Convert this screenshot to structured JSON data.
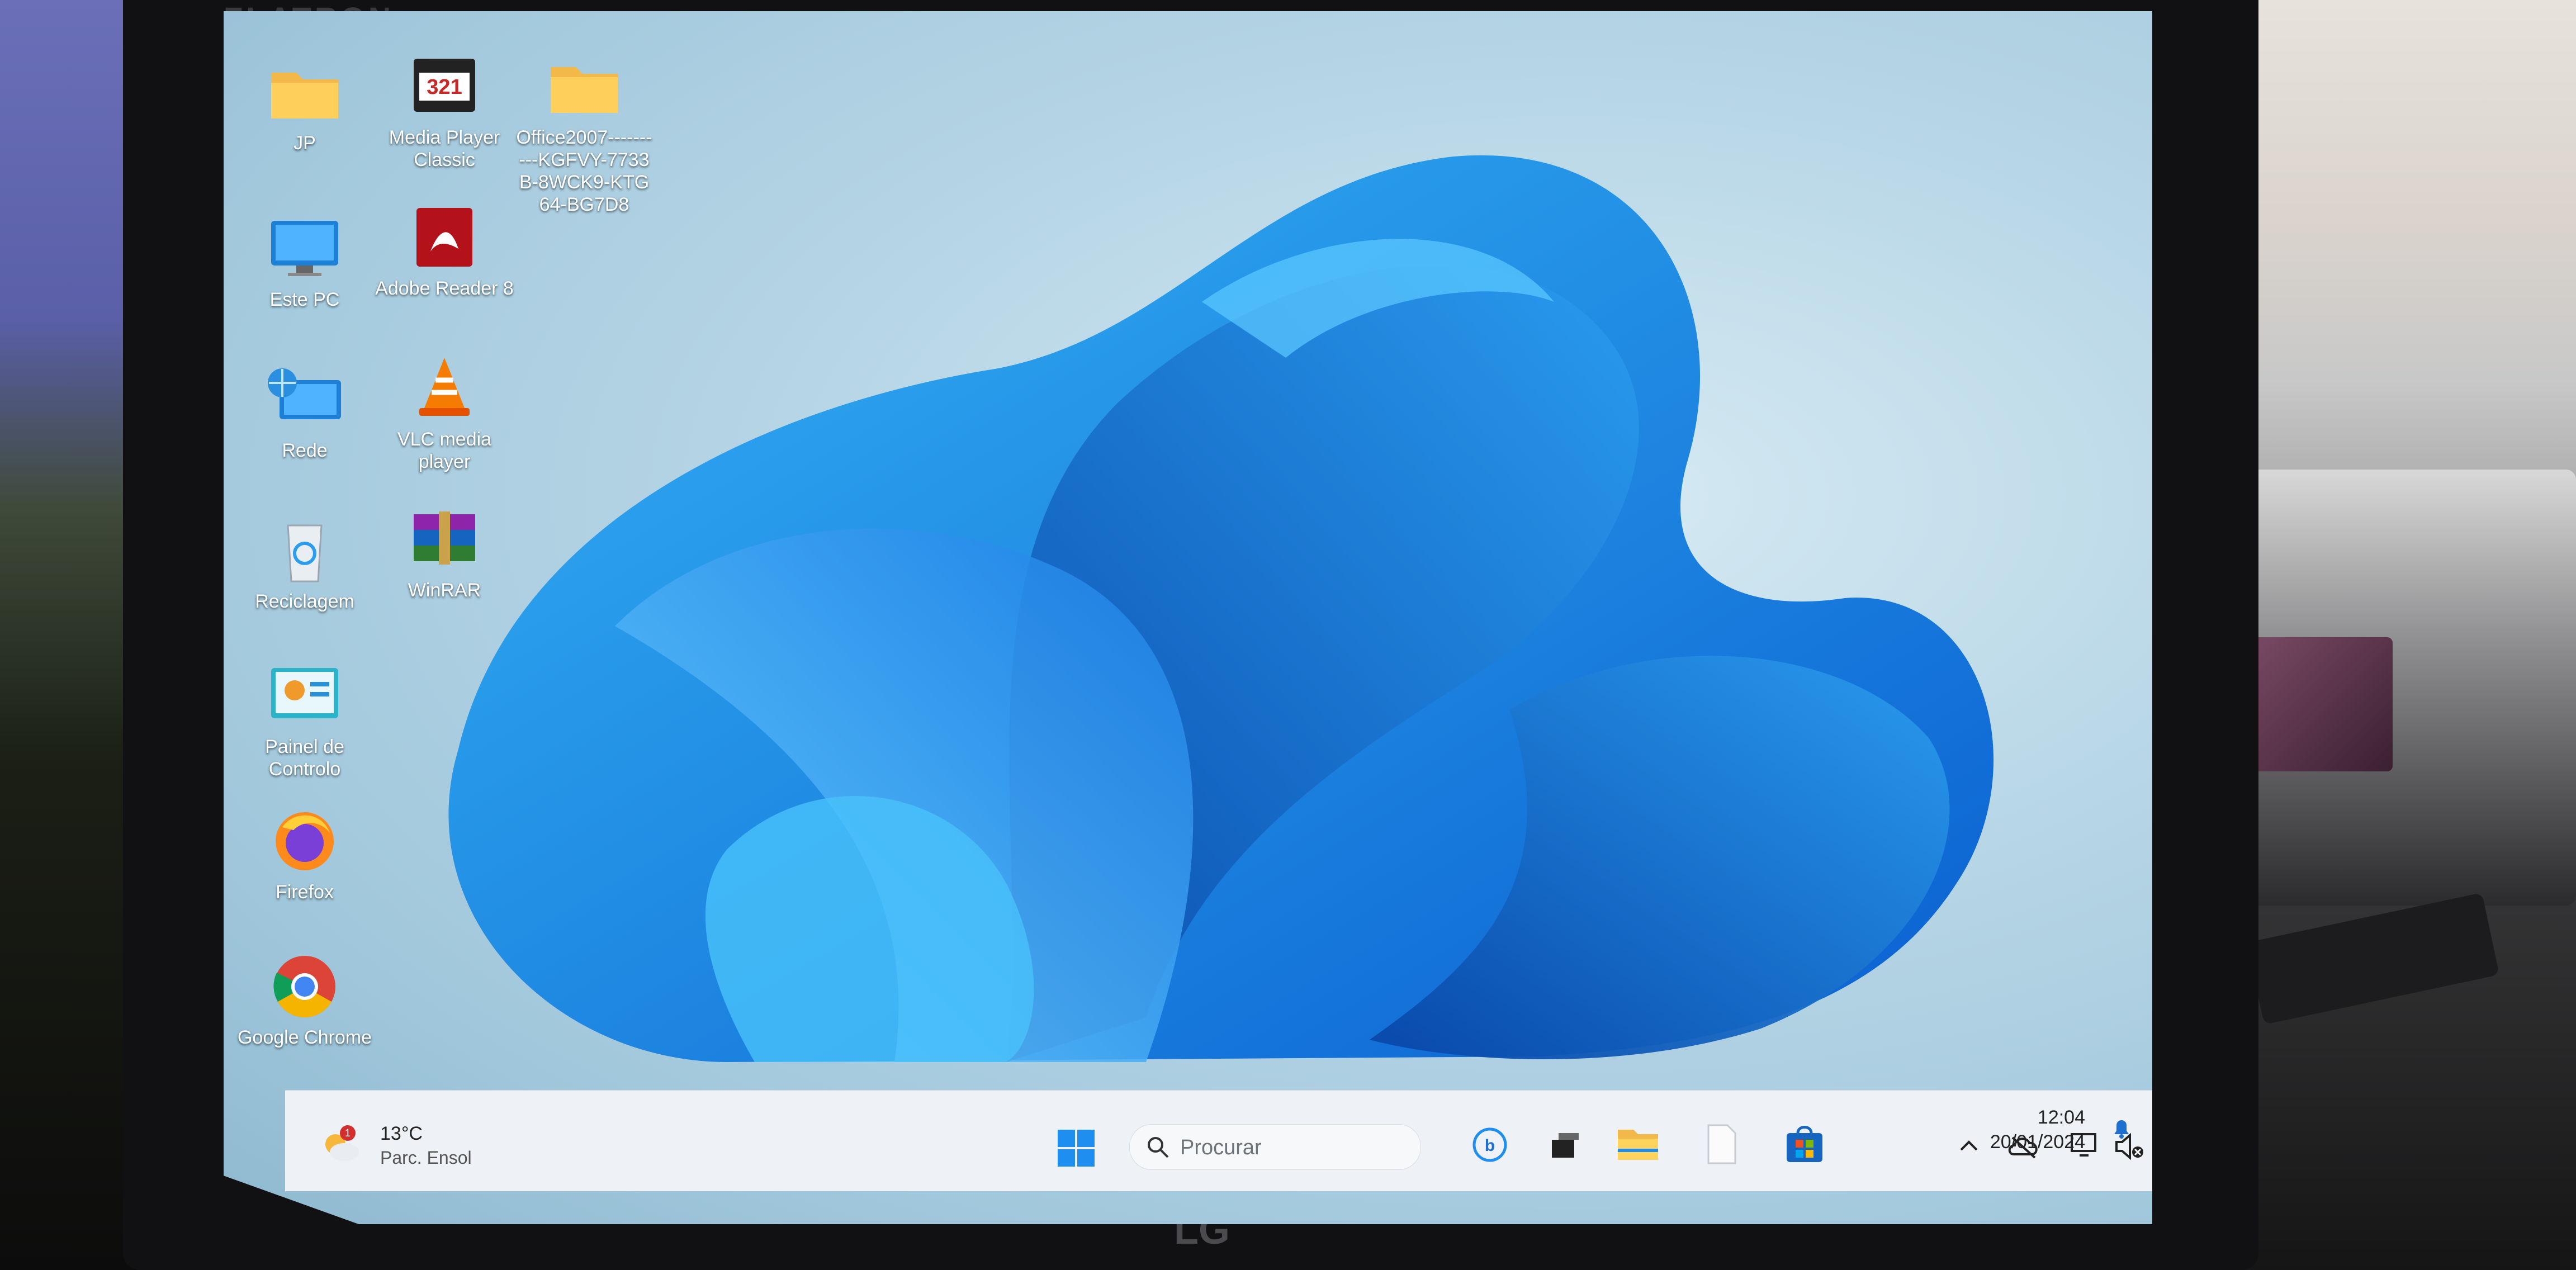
{
  "monitor": {
    "brand": "FLATRON",
    "logo": "LG"
  },
  "desktop": {
    "icons": [
      {
        "label": "JP",
        "icon": "folder-icon"
      },
      {
        "label": "Media Player Classic",
        "icon": "media-player-classic-icon"
      },
      {
        "label": "Office2007----------KGFVY-7733B-8WCK9-KTG64-BG7D8",
        "icon": "folder-icon"
      },
      {
        "label": "Este PC",
        "icon": "computer-icon"
      },
      {
        "label": "Adobe Reader 8",
        "icon": "adobe-reader-icon"
      },
      {
        "label": "Rede",
        "icon": "network-icon"
      },
      {
        "label": "VLC media player",
        "icon": "vlc-icon"
      },
      {
        "label": "Reciclagem",
        "icon": "recycle-bin-icon"
      },
      {
        "label": "WinRAR",
        "icon": "winrar-icon"
      },
      {
        "label": "Painel de Controlo",
        "icon": "control-panel-icon"
      },
      {
        "label": "Firefox",
        "icon": "firefox-icon"
      },
      {
        "label": "Google Chrome",
        "icon": "chrome-icon"
      }
    ]
  },
  "taskbar": {
    "weather": {
      "temperature": "13°C",
      "condition": "Parc. Ensol",
      "badge": "1"
    },
    "search_placeholder": "Procurar",
    "pinned": [
      "start-icon",
      "search-icon",
      "bing-icon",
      "task-view-icon",
      "file-explorer-icon",
      "notepad-icon",
      "store-icon"
    ],
    "tray": [
      "chevron-up-icon",
      "onedrive-icon",
      "network-icon",
      "volume-muted-icon"
    ],
    "time": "12:04",
    "date": "20/01/2024"
  },
  "colors": {
    "accent": "#0078d4",
    "taskbar_bg": "#eef1f5",
    "bloom": "#1e7fe0"
  }
}
